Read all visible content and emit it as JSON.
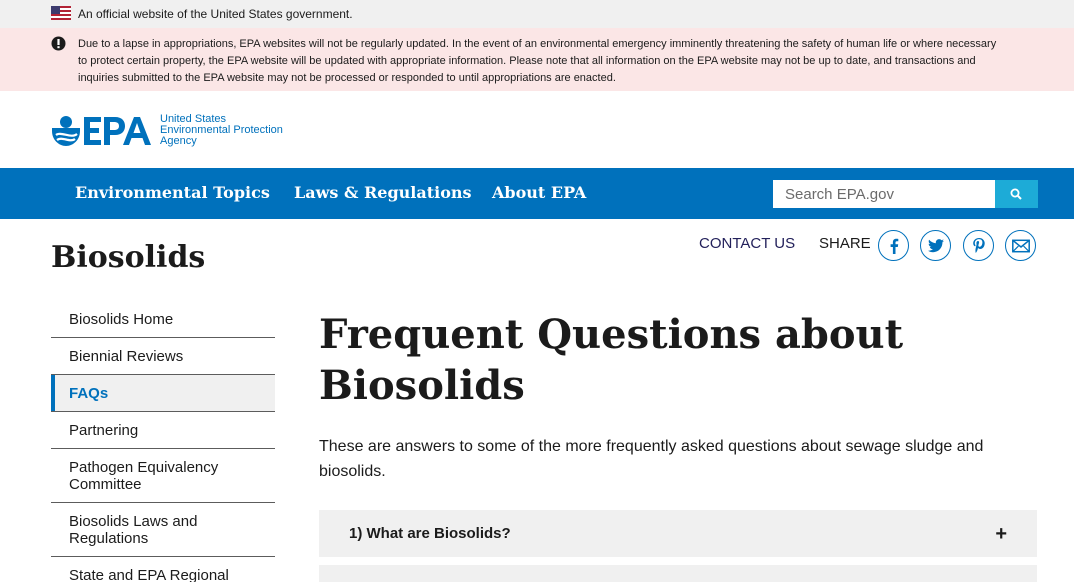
{
  "gov_banner": {
    "text": "An official website of the United States government."
  },
  "alert": {
    "text": "Due to a lapse in appropriations, EPA websites will not be regularly updated. In the event of an environmental emergency imminently threatening the safety of human life or where necessary to protect certain property, the EPA website will be updated with appropriate information. Please note that all information on the EPA website may not be up to date, and transactions and inquiries submitted to the EPA website may not be processed or responded to until appropriations are enacted."
  },
  "logo": {
    "name": "EPA",
    "agency_line1": "United States",
    "agency_line2": "Environmental Protection",
    "agency_line3": "Agency"
  },
  "nav": {
    "items": [
      {
        "label": "Environmental Topics"
      },
      {
        "label": "Laws & Regulations"
      },
      {
        "label": "About EPA"
      }
    ],
    "search_placeholder": "Search EPA.gov"
  },
  "page": {
    "section_title": "Biosolids",
    "contact": "CONTACT US",
    "share_label": "SHARE",
    "share_icons": [
      "facebook-icon",
      "twitter-icon",
      "pinterest-icon",
      "email-icon"
    ]
  },
  "sidebar": {
    "items": [
      {
        "label": "Biosolids Home"
      },
      {
        "label": "Biennial Reviews"
      },
      {
        "label": "FAQs",
        "active": true
      },
      {
        "label": "Partnering"
      },
      {
        "label": "Pathogen Equivalency Committee"
      },
      {
        "label": "Biosolids Laws and Regulations"
      },
      {
        "label": "State and EPA Regional"
      }
    ]
  },
  "main": {
    "title": "Frequent Questions about Biosolids",
    "intro": "These are answers to some of the more frequently asked questions about sewage sludge and biosolids.",
    "accordion": [
      {
        "label": "1) What are Biosolids?",
        "icon": "+"
      }
    ]
  },
  "colors": {
    "primary": "#0071bc",
    "alert_bg": "#fbe6e6",
    "search_button": "#1dabd7",
    "gov_bg": "#f0f0f0"
  }
}
